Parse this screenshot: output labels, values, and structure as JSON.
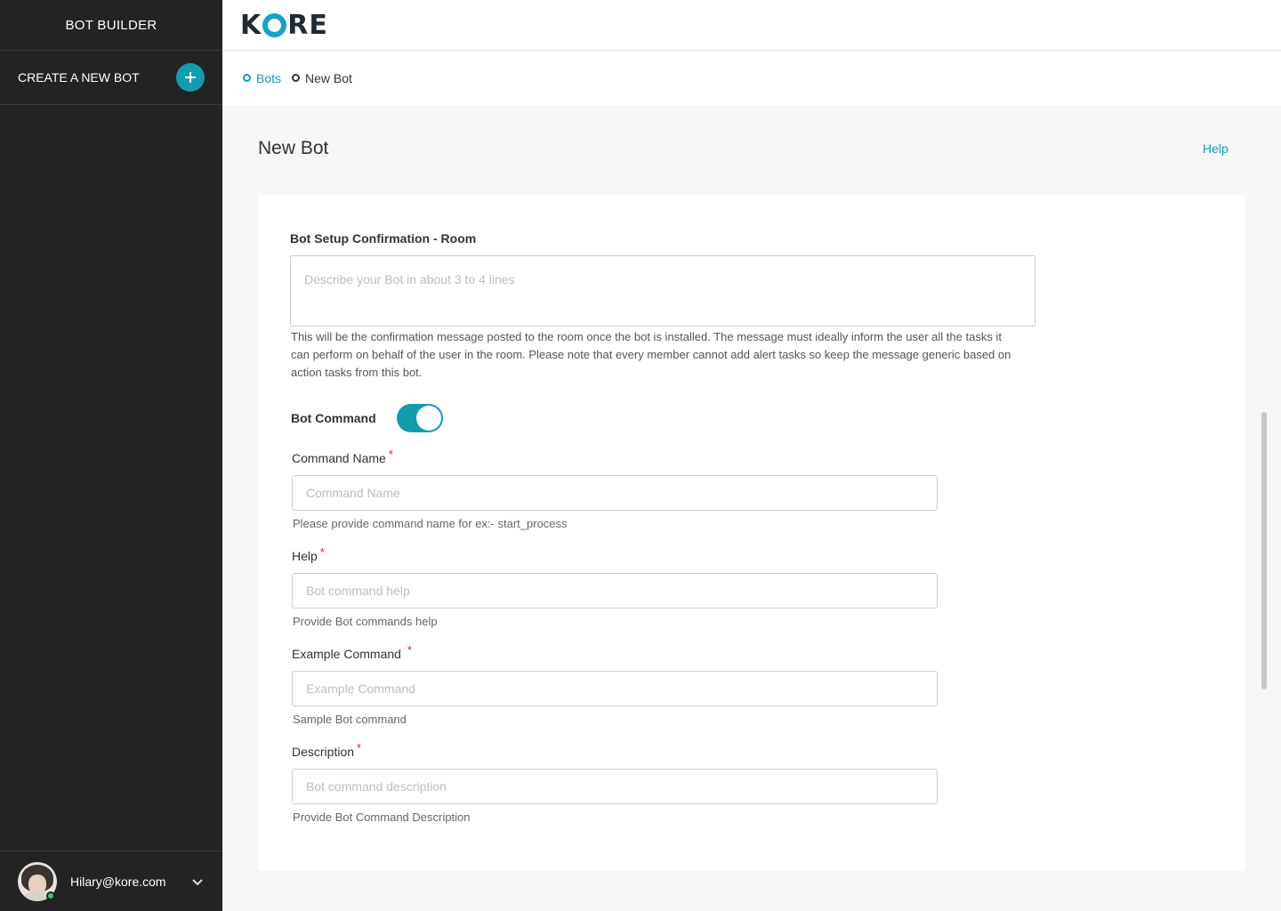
{
  "sidebar": {
    "title": "BOT BUILDER",
    "create_label": "CREATE A NEW BOT",
    "user_email": "Hilary@kore.com"
  },
  "header": {
    "logo_text_1": "K",
    "logo_text_2": "RE"
  },
  "breadcrumb": [
    {
      "label": "Bots"
    },
    {
      "label": "New Bot"
    }
  ],
  "page": {
    "title": "New Bot",
    "help_link": "Help"
  },
  "form": {
    "confirmation_label": "Bot Setup Confirmation - Room",
    "confirmation_placeholder": "Describe your Bot in about 3 to 4 lines",
    "confirmation_help": "This will be the confirmation message posted to the room once the bot is installed. The message must ideally inform the user all the tasks it can perform on behalf of the user in the room. Please note that every member cannot add alert tasks so keep the message generic based on action tasks from this bot.",
    "bot_command_label": "Bot Command",
    "bot_command_enabled": true,
    "required_mark": "*",
    "fields": [
      {
        "label": "Command Name",
        "placeholder": "Command Name",
        "help": "Please provide command name for ex:- start_process",
        "value": ""
      },
      {
        "label": "Help",
        "placeholder": "Bot command help",
        "help": "Provide Bot commands help",
        "value": ""
      },
      {
        "label": "Example Command",
        "placeholder": "Example Command",
        "help": "Sample Bot command",
        "value": ""
      },
      {
        "label": "Description",
        "placeholder": "Bot command description",
        "help": "Provide Bot Command Description",
        "value": ""
      }
    ]
  },
  "colors": {
    "accent": "#139cae",
    "sidebar_bg": "#232323",
    "required": "#e02020",
    "logo_ring": "#17a2c7"
  }
}
